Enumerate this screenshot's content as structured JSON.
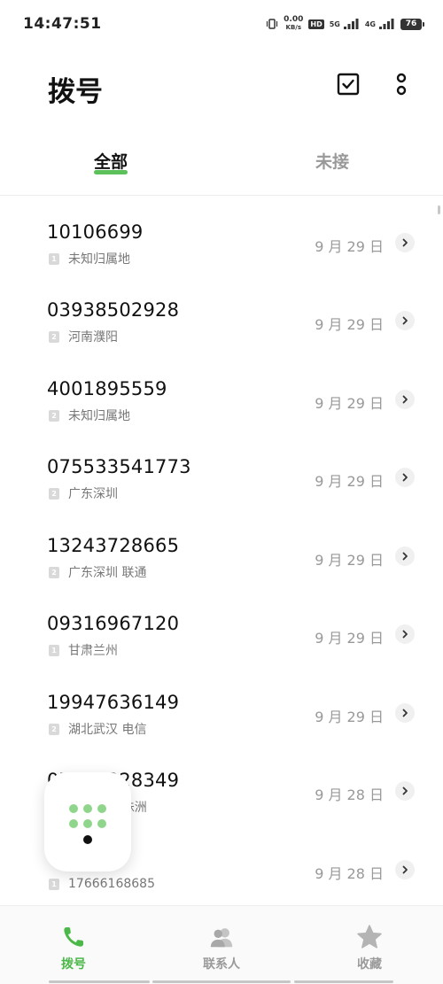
{
  "status_bar": {
    "time": "14:47:51",
    "net_speed_value": "0.00",
    "net_speed_unit": "KB/s",
    "hd_label": "HD",
    "signal1_label": "5G",
    "signal2_label": "4G",
    "battery": "76"
  },
  "header": {
    "title": "拨号",
    "select_icon": "checkbox-icon",
    "more_icon": "more-vertical-icon"
  },
  "tabs": [
    {
      "label": "全部",
      "active": true
    },
    {
      "label": "未接",
      "active": false
    }
  ],
  "calls": [
    {
      "number": "10106699",
      "sim": "1",
      "location": "未知归属地",
      "date": "9 月 29 日"
    },
    {
      "number": "03938502928",
      "sim": "2",
      "location": "河南濮阳",
      "date": "9 月 29 日"
    },
    {
      "number": "4001895559",
      "sim": "2",
      "location": "未知归属地",
      "date": "9 月 29 日"
    },
    {
      "number": "075533541773",
      "sim": "2",
      "location": "广东深圳",
      "date": "9 月 29 日"
    },
    {
      "number": "13243728665",
      "sim": "2",
      "location": "广东深圳  联通",
      "date": "9 月 29 日"
    },
    {
      "number": "09316967120",
      "sim": "1",
      "location": "甘肃兰州",
      "date": "9 月 29 日"
    },
    {
      "number": "19947636149",
      "sim": "2",
      "location": "湖北武汉  电信",
      "date": "9 月 29 日"
    },
    {
      "number": "07324328349",
      "sim": "2",
      "location": "湖南湘潭/株洲",
      "date": "9 月 28 日"
    },
    {
      "number": "",
      "sim": "1",
      "location": "17666168685",
      "date": "9 月 28 日"
    }
  ],
  "bottom_nav": [
    {
      "label": "拨号",
      "icon": "phone-icon",
      "active": true
    },
    {
      "label": "联系人",
      "icon": "contacts-icon",
      "active": false
    },
    {
      "label": "收藏",
      "icon": "star-icon",
      "active": false
    }
  ],
  "colors": {
    "accent": "#4cb84a",
    "inactive": "#9a9a9a",
    "dialpad_dot": "#8fd68c"
  }
}
